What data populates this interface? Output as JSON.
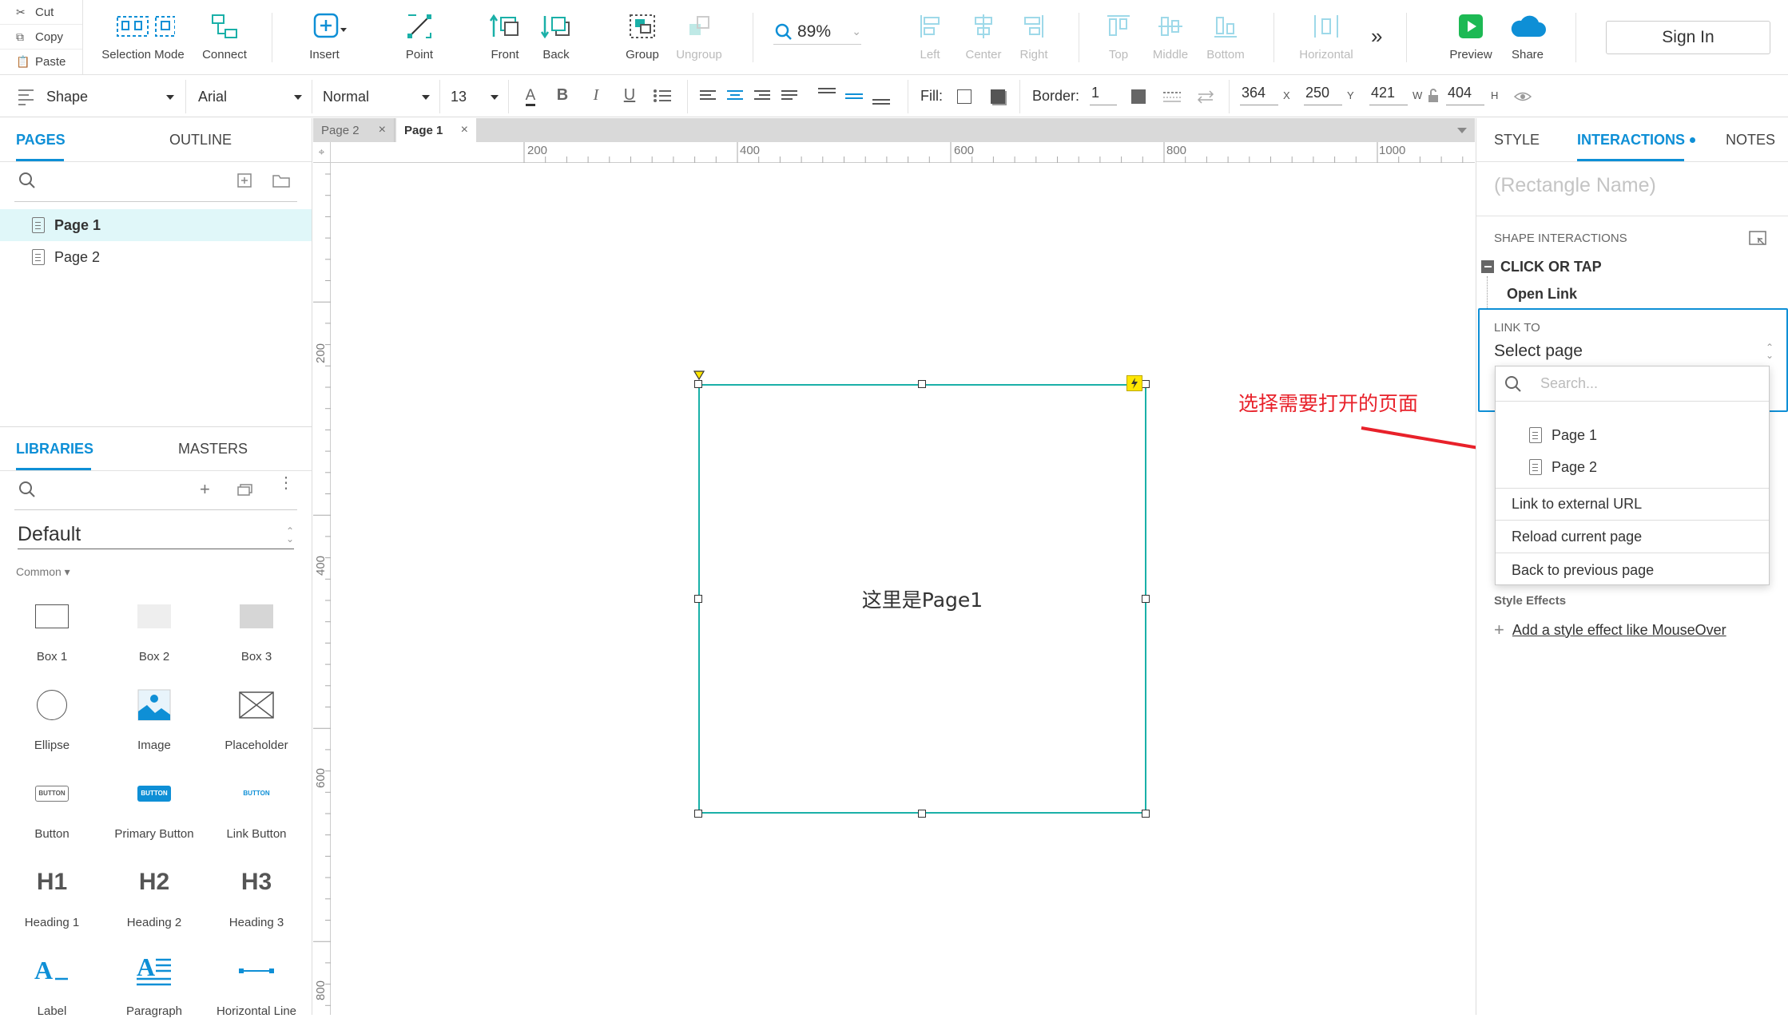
{
  "clipboard": {
    "cut": "Cut",
    "copy": "Copy",
    "paste": "Paste"
  },
  "toolbar": {
    "selection_mode": "Selection Mode",
    "connect": "Connect",
    "insert": "Insert",
    "point": "Point",
    "front": "Front",
    "back": "Back",
    "group": "Group",
    "ungroup": "Ungroup",
    "zoom": "89%",
    "left": "Left",
    "center": "Center",
    "right": "Right",
    "top": "Top",
    "middle": "Middle",
    "bottom": "Bottom",
    "horizontal": "Horizontal",
    "preview": "Preview",
    "share": "Share",
    "sign_in": "Sign In"
  },
  "format": {
    "widget_type": "Shape",
    "font_family": "Arial",
    "font_style": "Normal",
    "font_size": "13",
    "fill_label": "Fill:",
    "border_label": "Border:",
    "border_value": "1",
    "x_value": "364",
    "x_unit": "X",
    "y_value": "250",
    "y_unit": "Y",
    "w_value": "421",
    "w_unit": "W",
    "h_value": "404",
    "h_unit": "H"
  },
  "left_panel": {
    "tab_pages": "PAGES",
    "tab_outline": "OUTLINE",
    "pages": [
      "Page 1",
      "Page 2"
    ],
    "tab_libraries": "LIBRARIES",
    "tab_masters": "MASTERS",
    "library_name": "Default",
    "category": "Common ▾",
    "widgets": [
      "Box 1",
      "Box 2",
      "Box 3",
      "Ellipse",
      "Image",
      "Placeholder",
      "Button",
      "Primary Button",
      "Link Button",
      "Heading 1",
      "Heading 2",
      "Heading 3",
      "Label",
      "Paragraph",
      "Horizontal Line"
    ],
    "widget_glyphs": {
      "h1": "H1",
      "h2": "H2",
      "h3": "H3",
      "button": "BUTTON"
    }
  },
  "canvas": {
    "tabs": [
      "Page 2",
      "Page 1"
    ],
    "ruler_h": [
      "200",
      "400",
      "600",
      "800",
      "1000"
    ],
    "ruler_v": [
      "200",
      "400",
      "600",
      "800"
    ],
    "shape_text": "这里是Page1",
    "annotation": "选择需要打开的页面"
  },
  "right_panel": {
    "tab_style": "STYLE",
    "tab_interactions": "INTERACTIONS",
    "tab_notes": "NOTES",
    "name_placeholder": "(Rectangle Name)",
    "section": "SHAPE INTERACTIONS",
    "event": "CLICK OR TAP",
    "action": "Open Link",
    "link_to_label": "LINK TO",
    "link_select": "Select page",
    "search_placeholder": "Search...",
    "pages": [
      "Page 1",
      "Page 2"
    ],
    "options": [
      "Link to external URL",
      "Reload current page",
      "Back to previous page"
    ],
    "style_effects": "Style Effects",
    "add_style_effect": "Add a style effect like MouseOver"
  },
  "colors": {
    "accent": "#0e8fd6",
    "teal": "#1ab0a8",
    "annotation": "#e8212a",
    "preview": "#1db954"
  }
}
